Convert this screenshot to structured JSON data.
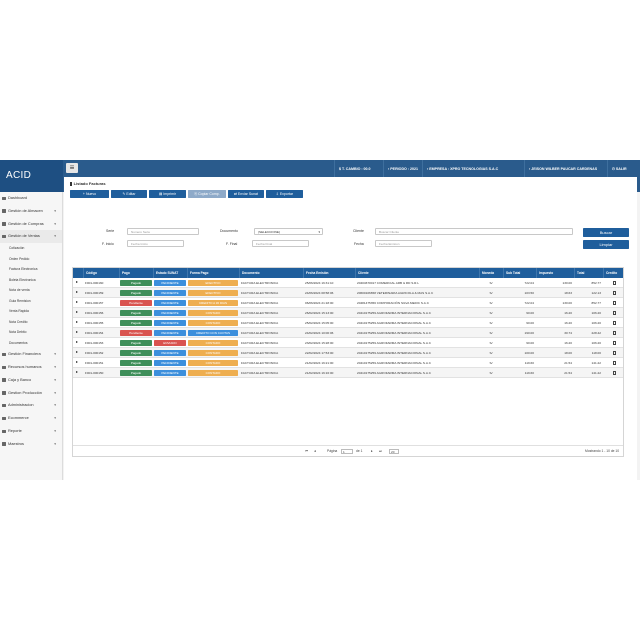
{
  "topbar": {
    "brand": "ACID",
    "tipo_cambio": "T. CAMBIO : 00.0",
    "periodo": "PERIODO : 2021",
    "empresa": "EMPRESA : XPRO TECNOLOGIAS S.A.C",
    "usuario": "JEISON WILBER PAUCAR CARDENAS",
    "salir": "SALIR"
  },
  "sidebar": {
    "items": [
      {
        "label": "Dashboard",
        "icon": "dashboard-icon"
      },
      {
        "label": "Gestión de Almacen",
        "icon": "warehouse-icon"
      },
      {
        "label": "Gestión de Compras",
        "icon": "cart-icon"
      },
      {
        "label": "Gestión de Ventas",
        "icon": "sales-icon"
      }
    ],
    "sub_items": [
      "Cotización",
      "Orden Pedido",
      "Factura Electronica",
      "Boleta Electronica",
      "Nota de venta",
      "Guia Remision",
      "Venta Rapida",
      "Nota Credito",
      "Nota Debito",
      "Documentos"
    ],
    "items_after": [
      {
        "label": "Gestión Financiera",
        "icon": "finance-icon"
      },
      {
        "label": "Recursos humanos",
        "icon": "people-icon"
      },
      {
        "label": "Caja y Banco",
        "icon": "bank-icon"
      },
      {
        "label": "Gestion Producción",
        "icon": "production-icon"
      },
      {
        "label": "Administracion",
        "icon": "admin-icon"
      },
      {
        "label": "Ecommerce",
        "icon": "ecommerce-icon"
      },
      {
        "label": "Reporte",
        "icon": "report-icon"
      },
      {
        "label": "Maestros",
        "icon": "masters-icon"
      }
    ]
  },
  "main": {
    "title": "Listado Facturas",
    "toolbar": {
      "nuevo": "Nuevo",
      "editar": "Editar",
      "imprimir": "Imprimir",
      "copiar": "Copiar Comp.",
      "enviar": "Enviar Sunat",
      "exportar": "Exportar"
    },
    "filters": {
      "serie_label": "Serie",
      "serie_placeholder": "Numero Serie",
      "documento_label": "Documento",
      "documento_value": "(SELECCIONE)",
      "cliente_label": "Cliente",
      "cliente_placeholder": "Buscar Cliente",
      "finicio_label": "F. Inicio",
      "finicio_placeholder": "Fecha Inicio",
      "ffinal_label": "F. Final",
      "ffinal_placeholder": "Fecha Final",
      "fecha_label": "Fecha",
      "fecha_placeholder": "Fecha Emision",
      "buscar": "Buscar",
      "limpiar": "Limpiar"
    },
    "table": {
      "headers": [
        "Código",
        "Pago",
        "Estado SUNAT",
        "Forma Pago",
        "Documento",
        "Fecha Emisión",
        "Cliente",
        "Moneda",
        "Sub Total",
        "Impuesto",
        "Total",
        "Credito"
      ],
      "rows": [
        {
          "codigo": "F001-000160",
          "pago": "Pagado",
          "sunat": "PENDIENTE",
          "forma": "EFECTIVO",
          "doc": "FACTURA ELECTRONICA",
          "fecha": "25/06/2024 16:31:10",
          "cliente": "20404670017 COMERCIAL ARB & RD S.R.L",
          "moneda": "S/",
          "subtotal": "722.04",
          "impuesto": "130.00",
          "total": "852.77"
        },
        {
          "codigo": "F001-000159",
          "pago": "Pagado",
          "sunat": "PENDIENTE",
          "forma": "EFECTIVO",
          "doc": "FACTURA ELECTRONICA",
          "fecha": "24/06/2024 08:58:06",
          "cliente": "20600106658 VETERINARIA AGRICOLA & MAS S.A.C",
          "moneda": "S/",
          "subtotal": "103.50",
          "impuesto": "18.63",
          "total": "122.13"
        },
        {
          "codigo": "F001-000157",
          "pago": "Pendiente",
          "sunat": "PENDIENTE",
          "forma": "CREDITO A 30 DIAS",
          "doc": "FACTURA ELECTRONICA",
          "fecha": "06/06/2024 21:18:00",
          "cliente": "20481475356 CORPORACIÓN SILVA MEDIC S.A.C",
          "moneda": "S/",
          "subtotal": "722.04",
          "impuesto": "130.00",
          "total": "852.77"
        },
        {
          "codigo": "F001-000156",
          "pago": "Pagado",
          "sunat": "PENDIENTE",
          "forma": "CONTADO",
          "doc": "FACTURA ELECTRONICA",
          "fecha": "26/02/2024 15:13:00",
          "cliente": "20410175259 AGROFARMA INTERNACIONAL S.A.C",
          "moneda": "S/",
          "subtotal": "90.00",
          "impuesto": "16.20",
          "total": "106.20"
        },
        {
          "codigo": "F001-000155",
          "pago": "Pagado",
          "sunat": "PENDIENTE",
          "forma": "CONTADO",
          "doc": "FACTURA ELECTRONICA",
          "fecha": "25/02/2024 15:05:00",
          "cliente": "20410175259 AGROFARMA INTERNACIONAL S.A.C",
          "moneda": "S/",
          "subtotal": "90.00",
          "impuesto": "16.20",
          "total": "106.20"
        },
        {
          "codigo": "F001-000154",
          "pago": "Pendiente",
          "sunat": "PENDIENTE",
          "forma": "CREDITO CON CUOTAS",
          "doc": "FACTURA ELECTRONICA",
          "fecha": "24/02/2024 10:00:06",
          "cliente": "20410175259 AGROFARMA INTERNACIONAL S.A.C",
          "moneda": "S/",
          "subtotal": "190.00",
          "impuesto": "30.74",
          "total": "228.42"
        },
        {
          "codigo": "F001-000153",
          "pago": "Pagado",
          "sunat": "ENVIADO",
          "forma": "CONTADO",
          "doc": "FACTURA ELECTRONICA",
          "fecha": "23/02/2024 15:28:00",
          "cliente": "20410175259 AGROFARMA INTERNACIONAL S.A.C",
          "moneda": "S/",
          "subtotal": "90.00",
          "impuesto": "16.20",
          "total": "106.20"
        },
        {
          "codigo": "F001-000152",
          "pago": "Pagado",
          "sunat": "PENDIENTE",
          "forma": "CONTADO",
          "doc": "FACTURA ELECTRONICA",
          "fecha": "22/02/2024 17:53:00",
          "cliente": "20410175259 AGROFARMA INTERNACIONAL S.A.C",
          "moneda": "S/",
          "subtotal": "100.00",
          "impuesto": "18.00",
          "total": "118.00"
        },
        {
          "codigo": "F001-000151",
          "pago": "Pagado",
          "sunat": "PENDIENTE",
          "forma": "CONTADO",
          "doc": "FACTURA ELECTRONICA",
          "fecha": "21/02/2024 16:21:00",
          "cliente": "20410175259 AGROFARMA INTERNACIONAL S.A.C",
          "moneda": "S/",
          "subtotal": "119.60",
          "impuesto": "21.54",
          "total": "141.22"
        },
        {
          "codigo": "F001-000150",
          "pago": "Pagado",
          "sunat": "PENDIENTE",
          "forma": "CONTADO",
          "doc": "FACTURA ELECTRONICA",
          "fecha": "21/02/2024 16:16:00",
          "cliente": "20410175259 AGROFARMA INTERNACIONAL S.A.C",
          "moneda": "S/",
          "subtotal": "119.60",
          "impuesto": "21.54",
          "total": "141.22"
        }
      ]
    },
    "pager": {
      "page_label": "Página",
      "page_value": "1",
      "of_label": "de 1",
      "page_size": "20",
      "summary": "Mostrando 1 - 10 de 10"
    }
  },
  "colors": {
    "pagado": "#3f8f5a",
    "pendiente_pago": "#d9534f",
    "sunat_pendiente": "#3c8fdc",
    "sunat_enviado": "#d9534f",
    "forma_contado": "#eeae50",
    "forma_credito": "#3c8fdc"
  }
}
